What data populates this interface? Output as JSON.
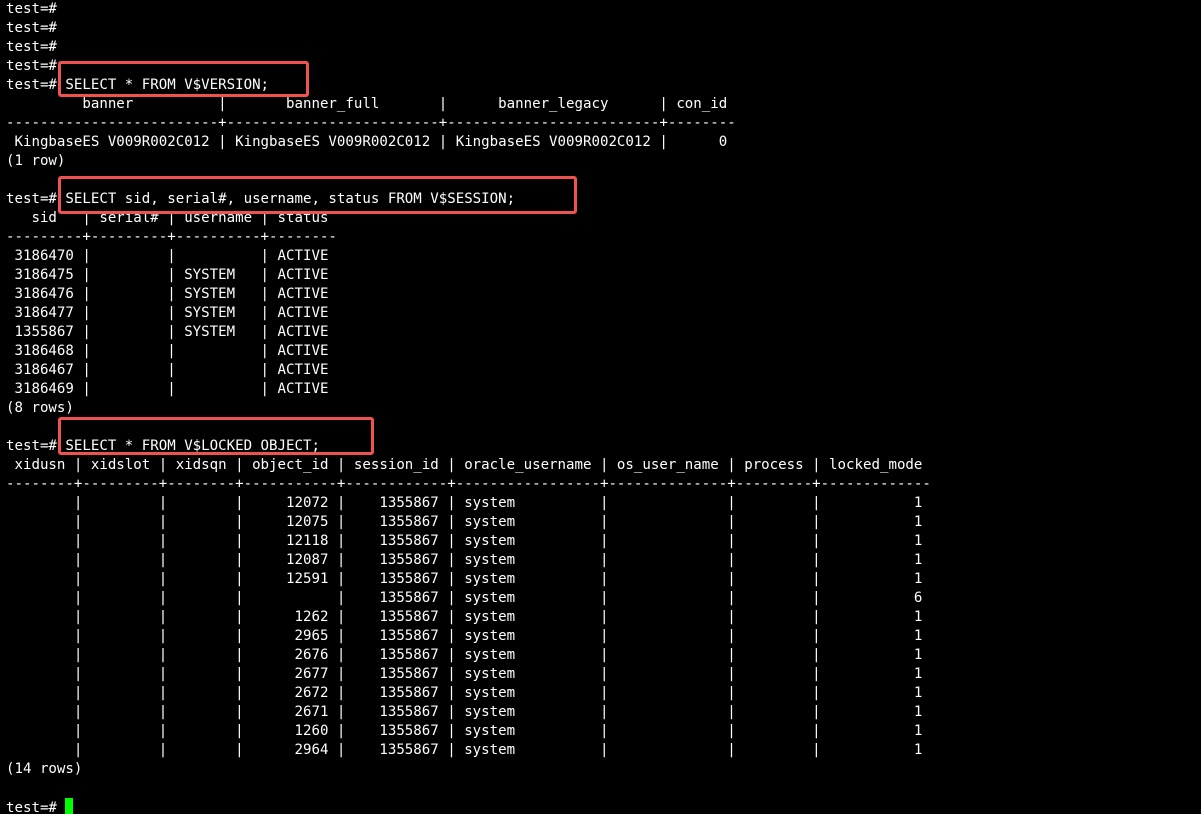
{
  "terminal": {
    "prompt": "test=#",
    "cursor_color": "#00ff00",
    "highlight_color": "#f0524f",
    "lines": [
      "test=#",
      "test=#",
      "test=#",
      "test=#",
      "test=# SELECT * FROM V$VERSION;",
      "         banner          |       banner_full       |      banner_legacy      | con_id",
      "-------------------------+-------------------------+-------------------------+--------",
      " KingbaseES V009R002C012 | KingbaseES V009R002C012 | KingbaseES V009R002C012 |      0",
      "(1 row)",
      "",
      "test=# SELECT sid, serial#, username, status FROM V$SESSION;",
      "   sid   | serial# | username | status",
      "---------+---------+----------+--------",
      " 3186470 |         |          | ACTIVE",
      " 3186475 |         | SYSTEM   | ACTIVE",
      " 3186476 |         | SYSTEM   | ACTIVE",
      " 3186477 |         | SYSTEM   | ACTIVE",
      " 1355867 |         | SYSTEM   | ACTIVE",
      " 3186468 |         |          | ACTIVE",
      " 3186467 |         |          | ACTIVE",
      " 3186469 |         |          | ACTIVE",
      "(8 rows)",
      "",
      "test=# SELECT * FROM V$LOCKED_OBJECT;",
      " xidusn | xidslot | xidsqn | object_id | session_id | oracle_username | os_user_name | process | locked_mode",
      "--------+---------+--------+-----------+------------+-----------------+--------------+---------+-------------",
      "        |         |        |     12072 |    1355867 | system          |              |         |           1",
      "        |         |        |     12075 |    1355867 | system          |              |         |           1",
      "        |         |        |     12118 |    1355867 | system          |              |         |           1",
      "        |         |        |     12087 |    1355867 | system          |              |         |           1",
      "        |         |        |     12591 |    1355867 | system          |              |         |           1",
      "        |         |        |           |    1355867 | system          |              |         |           6",
      "        |         |        |      1262 |    1355867 | system          |              |         |           1",
      "        |         |        |      2965 |    1355867 | system          |              |         |           1",
      "        |         |        |      2676 |    1355867 | system          |              |         |           1",
      "        |         |        |      2677 |    1355867 | system          |              |         |           1",
      "        |         |        |      2672 |    1355867 | system          |              |         |           1",
      "        |         |        |      2671 |    1355867 | system          |              |         |           1",
      "        |         |        |      1260 |    1355867 | system          |              |         |           1",
      "        |         |        |      2964 |    1355867 | system          |              |         |           1",
      "(14 rows)",
      "",
      "test=# "
    ]
  }
}
